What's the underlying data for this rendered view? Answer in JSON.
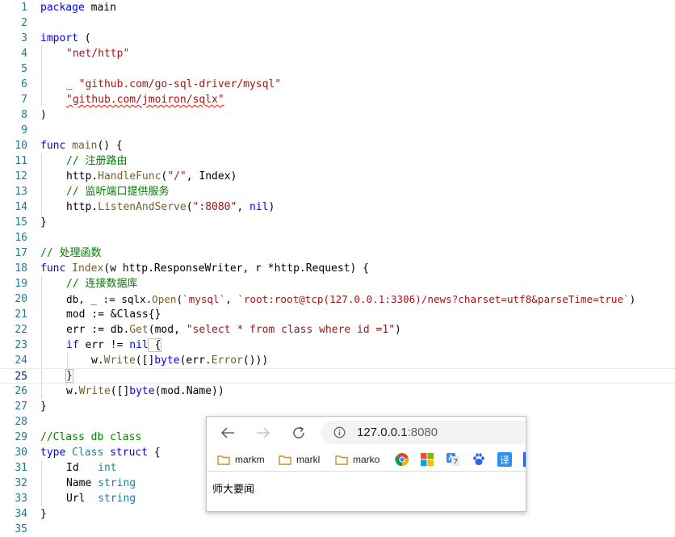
{
  "editor": {
    "line_numbers": [
      "1",
      "2",
      "3",
      "4",
      "5",
      "6",
      "7",
      "8",
      "9",
      "10",
      "11",
      "12",
      "13",
      "14",
      "15",
      "16",
      "17",
      "18",
      "19",
      "20",
      "21",
      "22",
      "23",
      "24",
      "25",
      "26",
      "27",
      "28",
      "29",
      "30",
      "31",
      "32",
      "33",
      "34",
      "35"
    ],
    "lines": {
      "l1_kw": "package",
      "l1_rest": " main",
      "l3_kw": "import",
      "l3_rest": " (",
      "l4_str": "\"net/http\"",
      "l6_pre": "_ ",
      "l6_str": "\"github.com/go-sql-driver/mysql\"",
      "l7_str": "\"github.com/jmoiron/sqlx\"",
      "l8": ")",
      "l10_kw": "func",
      "l10_fn": "main",
      "l10_rest": "() {",
      "l11_cm": "// 注册路由",
      "l12_a": "http.",
      "l12_fn": "HandleFunc",
      "l12_b": "(",
      "l12_str": "\"/\"",
      "l12_c": ", Index)",
      "l13_cm": "// 监听端口提供服务",
      "l14_a": "http.",
      "l14_fn": "ListenAndServe",
      "l14_b": "(",
      "l14_str": "\":8080\"",
      "l14_c": ", ",
      "l14_kw": "nil",
      "l14_d": ")",
      "l15": "}",
      "l17_cm": "// 处理函数",
      "l18_kw": "func",
      "l18_fn": "Index",
      "l18_rest": "(w http.ResponseWriter, r *http.Request) {",
      "l19_cm": "// 连接数据库",
      "l20_a": "db, _ := sqlx.",
      "l20_fn": "Open",
      "l20_b": "(",
      "l20_str1": "`mysql`",
      "l20_c": ", ",
      "l20_str2": "`root:root@tcp(127.0.0.1:3306)/news?charset=utf8&parseTime=true`",
      "l20_d": ")",
      "l21": "mod := &Class{}",
      "l22_a": "err := db.",
      "l22_fn": "Get",
      "l22_b": "(mod, ",
      "l22_str": "\"select * from class where id =1\"",
      "l22_c": ")",
      "l23_kw1": "if",
      "l23_a": " err != ",
      "l23_kw2": "nil",
      "l23_b": " {",
      "l24_a": "w.",
      "l24_fn1": "Write",
      "l24_b": "([]",
      "l24_kw": "byte",
      "l24_c": "(err.",
      "l24_fn2": "Error",
      "l24_d": "()))",
      "l25": "}",
      "l26_a": "w.",
      "l26_fn": "Write",
      "l26_b": "([]",
      "l26_kw": "byte",
      "l26_c": "(mod.Name))",
      "l27": "}",
      "l29_cm": "//Class db class",
      "l30_kw1": "type",
      "l30_ty": "Class",
      "l30_kw2": "struct",
      "l30_rest": " {",
      "l31_a": "Id   ",
      "l31_ty": "int",
      "l32_a": "Name ",
      "l32_ty": "string",
      "l33_a": "Url  ",
      "l33_ty": "string",
      "l34": "}"
    }
  },
  "browser": {
    "back_icon": "arrow-left-icon",
    "forward_icon": "arrow-right-icon",
    "reload_icon": "reload-icon",
    "url_host": "127.0.0.1",
    "url_port": ":8080",
    "bookmarks": [
      {
        "label": "markm"
      },
      {
        "label": "markl"
      },
      {
        "label": "marko"
      }
    ],
    "page_heading": "师大要闻"
  }
}
